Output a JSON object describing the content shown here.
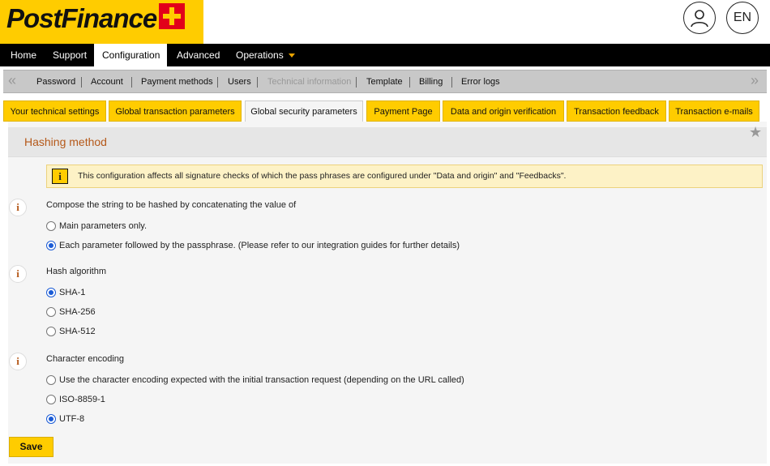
{
  "brand": {
    "logo_text": "PostFinance"
  },
  "header": {
    "language": "EN"
  },
  "main_nav": [
    {
      "label": "Home",
      "dropdown": false,
      "active": false
    },
    {
      "label": "Support",
      "dropdown": false,
      "active": false
    },
    {
      "label": "Configuration",
      "dropdown": true,
      "active": true
    },
    {
      "label": "Advanced",
      "dropdown": true,
      "active": false
    },
    {
      "label": "Operations",
      "dropdown": true,
      "active": false
    }
  ],
  "sub_nav": [
    {
      "label": "Password",
      "disabled": false
    },
    {
      "label": "Account",
      "disabled": false
    },
    {
      "label": "Payment methods",
      "disabled": false
    },
    {
      "label": "Users",
      "disabled": false
    },
    {
      "label": "Technical information",
      "disabled": true
    },
    {
      "label": "Template",
      "disabled": false
    },
    {
      "label": "Billing",
      "disabled": false
    },
    {
      "label": "Error logs",
      "disabled": false
    }
  ],
  "tabs": [
    {
      "label": "Your technical settings",
      "active": false
    },
    {
      "label": "Global transaction parameters",
      "active": false
    },
    {
      "label": "Global security parameters",
      "active": true
    },
    {
      "label": "Payment Page",
      "active": false
    },
    {
      "label": "Data and origin verification",
      "active": false
    },
    {
      "label": "Transaction feedback",
      "active": false
    },
    {
      "label": "Transaction e-mails",
      "active": false
    }
  ],
  "section": {
    "title": "Hashing method"
  },
  "alert": {
    "text": "This configuration affects all signature checks of which the pass phrases are configured under \"Data and origin\" and \"Feedbacks\"."
  },
  "compose": {
    "label": "Compose the string to be hashed by concatenating the value of",
    "options": [
      {
        "label": "Main parameters only.",
        "checked": false
      },
      {
        "label": "Each parameter followed by the passphrase. (Please refer to our integration guides for further details)",
        "checked": true
      }
    ]
  },
  "hash": {
    "label": "Hash algorithm",
    "options": [
      {
        "label": "SHA-1",
        "checked": true
      },
      {
        "label": "SHA-256",
        "checked": false
      },
      {
        "label": "SHA-512",
        "checked": false
      }
    ]
  },
  "encoding": {
    "label": "Character encoding",
    "options": [
      {
        "label": "Use the character encoding expected with the initial transaction request (depending on the URL called)",
        "checked": false
      },
      {
        "label": "ISO-8859-1",
        "checked": false
      },
      {
        "label": "UTF-8",
        "checked": true
      }
    ]
  },
  "save_label": "Save",
  "colors": {
    "brand_yellow": "#ffcc00",
    "accent_orange": "#b5591a",
    "radio_blue": "#1a5bd6"
  }
}
